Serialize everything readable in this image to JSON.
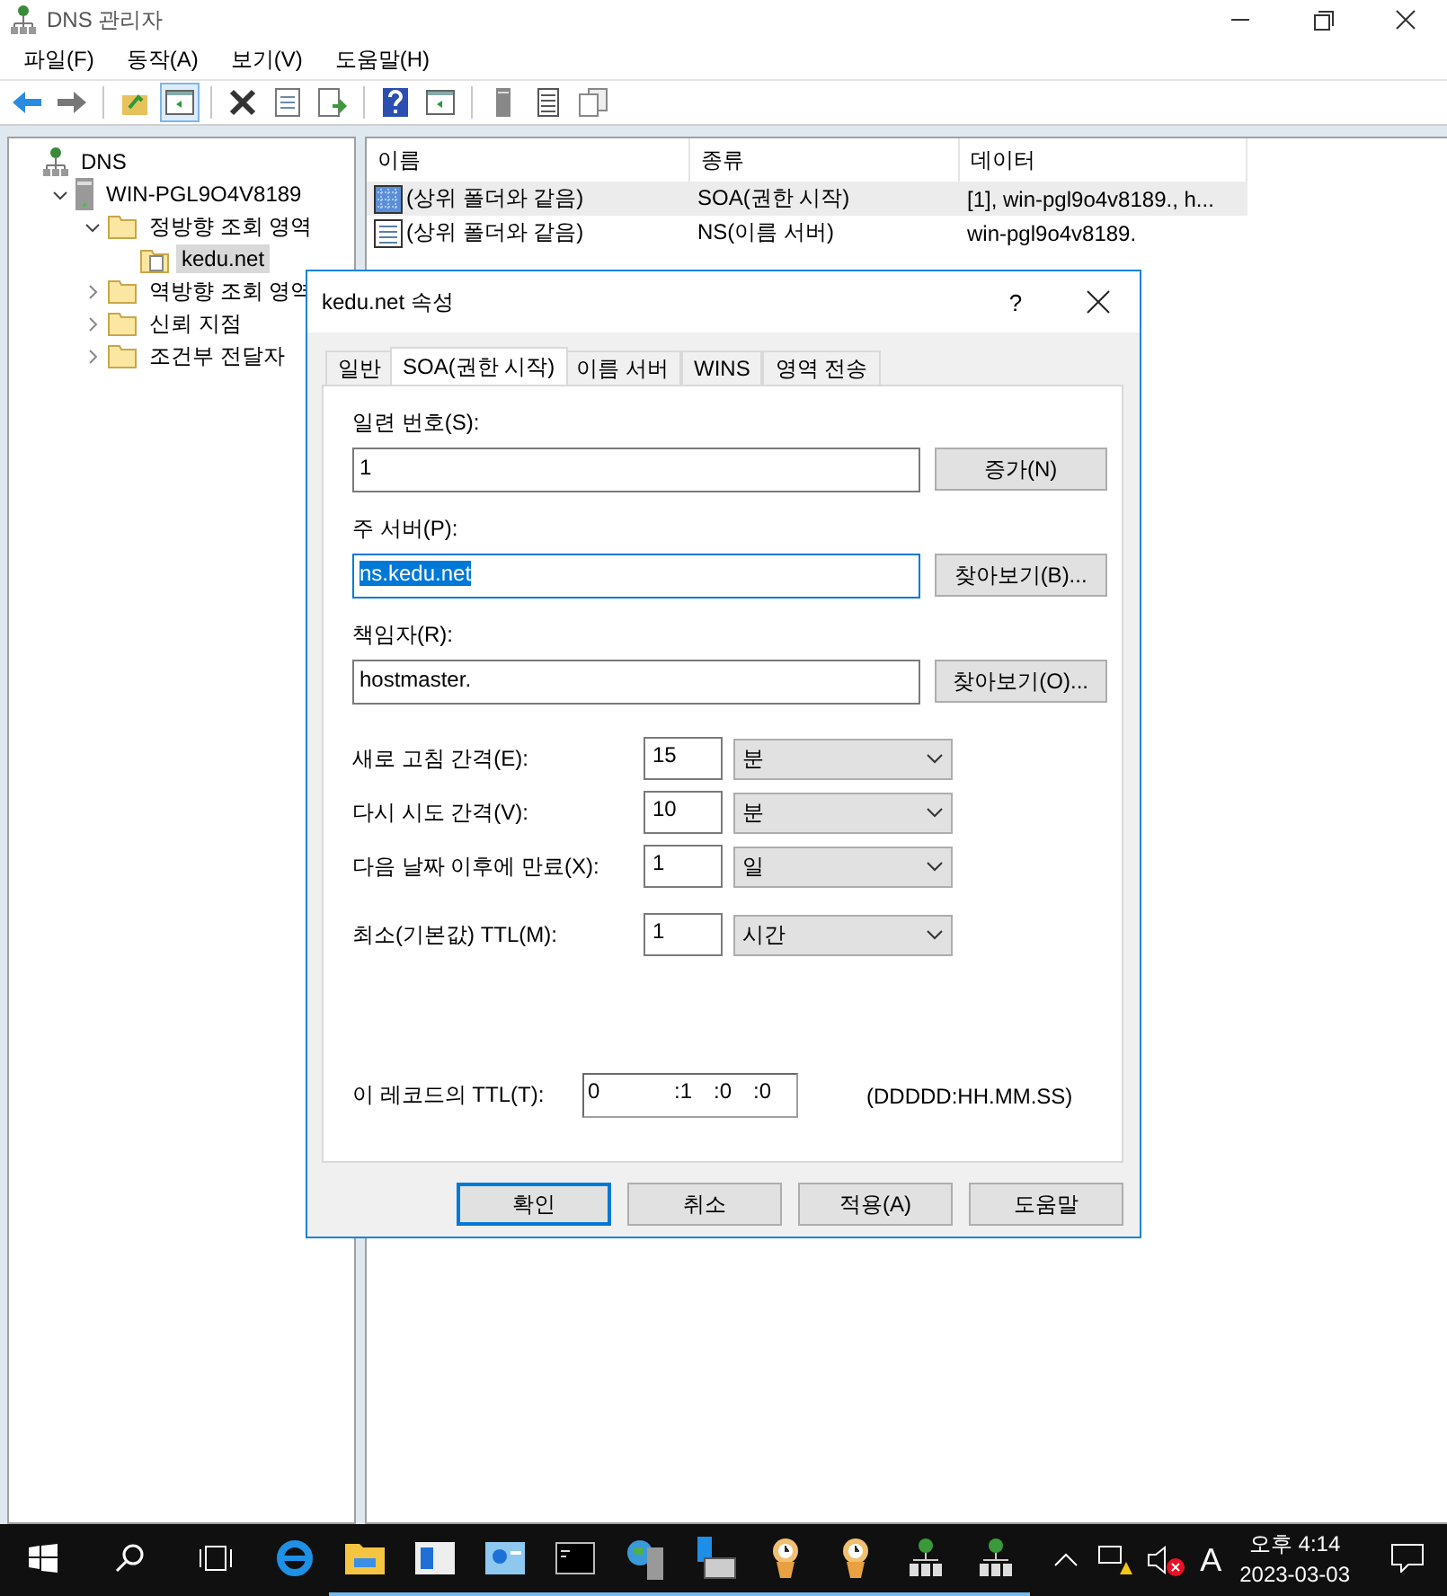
{
  "window": {
    "title": "DNS 관리자"
  },
  "menu": [
    "파일(F)",
    "동작(A)",
    "보기(V)",
    "도움말(H)"
  ],
  "toolbar": [
    {
      "kind": "back"
    },
    {
      "kind": "forward"
    },
    {
      "kind": "sep"
    },
    {
      "kind": "up"
    },
    {
      "kind": "pane",
      "selected": true
    },
    {
      "kind": "sep"
    },
    {
      "kind": "delete"
    },
    {
      "kind": "props"
    },
    {
      "kind": "export"
    },
    {
      "kind": "sep"
    },
    {
      "kind": "help"
    },
    {
      "kind": "pane2"
    },
    {
      "kind": "sep"
    },
    {
      "kind": "server"
    },
    {
      "kind": "list"
    },
    {
      "kind": "copy"
    }
  ],
  "tree": [
    {
      "label": "DNS",
      "kind": "dns",
      "children": [
        {
          "label": "WIN-PGL9O4V8189",
          "kind": "server",
          "expanded": true,
          "children": [
            {
              "label": "정방향 조회 영역",
              "kind": "folder",
              "expanded": true,
              "children": [
                {
                  "label": "kedu.net",
                  "kind": "zone",
                  "selected": true
                }
              ]
            },
            {
              "label": "역방향 조회 영역",
              "kind": "folder",
              "expanded": false
            },
            {
              "label": "신뢰 지점",
              "kind": "folder",
              "expanded": false
            },
            {
              "label": "조건부 전달자",
              "kind": "folder",
              "expanded": false
            }
          ]
        }
      ]
    }
  ],
  "list": {
    "columns": [
      "이름",
      "종류",
      "데이터"
    ],
    "rows": [
      {
        "name": "(상위 폴더와 같음)",
        "type": "SOA(권한 시작)",
        "data": "[1], win-pgl9o4v8189., h...",
        "kind": "soa",
        "selected": true
      },
      {
        "name": "(상위 폴더와 같음)",
        "type": "NS(이름 서버)",
        "data": "win-pgl9o4v8189.",
        "kind": "record",
        "selected": false
      }
    ]
  },
  "dialog": {
    "title": "kedu.net 속성",
    "help": "?",
    "tabs": [
      {
        "label": "일반",
        "selected": false
      },
      {
        "label": "SOA(권한 시작)",
        "selected": true
      },
      {
        "label": "이름 서버",
        "selected": false
      },
      {
        "label": "WINS",
        "selected": false
      },
      {
        "label": "영역 전송",
        "selected": false
      }
    ],
    "fields": [
      {
        "label": "일련 번호(S):",
        "value": "1",
        "button": "증가(N)",
        "text_selected": false
      },
      {
        "label": "주 서버(P):",
        "value": "ns.kedu.net",
        "button": "찾아보기(B)...",
        "text_selected": true
      },
      {
        "label": "책임자(R):",
        "value": "hostmaster.",
        "button": "찾아보기(O)...",
        "text_selected": false
      }
    ],
    "intervals": [
      {
        "label": "새로 고침 간격(E):",
        "value": "15",
        "unit": "분"
      },
      {
        "label": "다시 시도 간격(V):",
        "value": "10",
        "unit": "분"
      },
      {
        "label": "다음 날짜 이후에 만료(X):",
        "value": "1",
        "unit": "일"
      },
      {
        "label": "최소(기본값) TTL(M):",
        "value": "1",
        "unit": "시간"
      }
    ],
    "ttl": {
      "label": "이 레코드의 TTL(T):",
      "parts": [
        "0",
        ":1",
        ":0",
        ":0"
      ],
      "format": "(DDDDD:HH.MM.SS)"
    },
    "buttons": [
      {
        "label": "확인",
        "default": true
      },
      {
        "label": "취소",
        "default": false
      },
      {
        "label": "적용(A)",
        "default": false
      },
      {
        "label": "도움말",
        "default": false
      }
    ]
  },
  "taskbar": {
    "apps": [
      {
        "kind": "ie",
        "running": false
      },
      {
        "kind": "explorer",
        "running": true
      },
      {
        "kind": "window",
        "running": true
      },
      {
        "kind": "panel",
        "running": true
      },
      {
        "kind": "cmd",
        "running": true
      },
      {
        "kind": "globe",
        "running": true
      },
      {
        "kind": "network",
        "running": true
      },
      {
        "kind": "clock",
        "running": true
      },
      {
        "kind": "clock",
        "running": true
      },
      {
        "kind": "dns",
        "running": true
      },
      {
        "kind": "dns",
        "running": true
      }
    ],
    "ime": "A",
    "time": "오후 4:14",
    "date": "2023-03-03"
  }
}
